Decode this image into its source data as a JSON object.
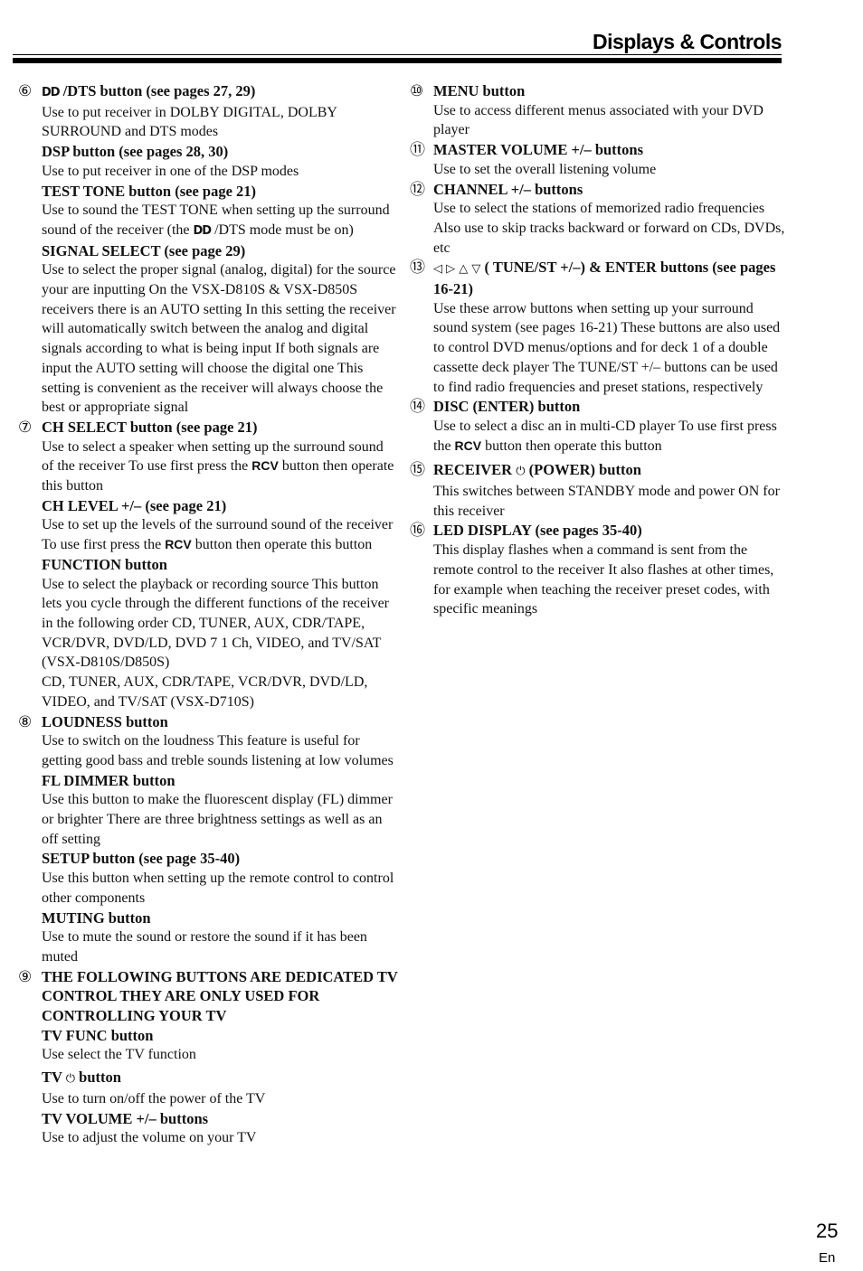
{
  "header": {
    "title": "Displays & Controls"
  },
  "footer": {
    "page_number": "25",
    "language": "En"
  },
  "icons": {
    "dolby": "DD",
    "power": "⏻",
    "arrows": "◁ ▷ △ ▽",
    "rcv": "RCV"
  },
  "left_column": {
    "item6": {
      "num": "⑥",
      "dts_heading_suffix": " /DTS  button (see pages 27, 29)",
      "dts_body": "Use to put receiver in DOLBY DIGITAL, DOLBY SURROUND and DTS modes",
      "dsp_heading": "DSP button (see pages 28, 30)",
      "dsp_body": "Use to put receiver in one of the DSP modes",
      "test_tone_heading": "TEST TONE button (see page 21)",
      "test_tone_body_a": "Use to sound the TEST TONE when setting up the surround sound of the receiver (the ",
      "test_tone_body_b": " /DTS mode must be on)",
      "signal_heading": "SIGNAL SELECT (see page 29)",
      "signal_body": "Use to select the proper signal (analog, digital) for the source your are inputting  On the VSX-D810S & VSX-D850S receivers there is an AUTO setting  In this setting the receiver will automatically switch between the analog and digital signals according to what is being input  If both signals are input the AUTO setting will choose the digital one  This setting is convenient as the receiver will always choose the best  or appropriate signal"
    },
    "item7": {
      "num": "⑦",
      "ch_select_heading": "CH SELECT button (see page 21)",
      "ch_select_body_a": "Use to select a speaker when setting up the surround sound of the receiver  To use first press the ",
      "ch_select_body_b": " button then operate this button",
      "ch_level_heading": "CH LEVEL +/– (see page 21)",
      "ch_level_body_a": "Use to set up the levels of the surround sound of the receiver  To use first press the ",
      "ch_level_body_b": " button then operate this button",
      "function_heading": "FUNCTION button",
      "function_body_1": "Use to select the playback or recording source  This button lets you cycle through the different functions of the receiver in the following order  CD, TUNER, AUX, CDR/TAPE, VCR/DVR, DVD/LD, DVD 7 1 Ch, VIDEO, and TV/SAT (VSX-D810S/D850S)",
      "function_body_2": "CD, TUNER, AUX, CDR/TAPE, VCR/DVR, DVD/LD, VIDEO, and TV/SAT (VSX-D710S)"
    },
    "item8": {
      "num": "⑧",
      "loudness_heading": "LOUDNESS button",
      "loudness_body": "Use to switch on the loudness  This feature is useful for getting good bass and treble sounds listening at low volumes",
      "fl_dimmer_heading": "FL DIMMER button",
      "fl_dimmer_body": "Use this button to make the fluorescent display (FL) dimmer or brighter  There are three brightness settings as well as an off setting",
      "setup_heading": "SETUP button (see page 35-40)",
      "setup_body": "Use this button when setting up the remote control to control other components",
      "muting_heading": "MUTING button",
      "muting_body": "Use to mute the sound or restore the sound if it has been muted"
    },
    "item9": {
      "num": "⑨",
      "heading": "THE FOLLOWING BUTTONS ARE DEDICATED TV CONTROL  THEY ARE ONLY USED FOR CONTROLLING YOUR TV",
      "tv_func_heading": "TV FUNC button",
      "tv_func_body": "Use select the TV function",
      "tv_power_heading_a": "TV ",
      "tv_power_heading_b": " button",
      "tv_power_body": "Use to turn on/off the power of the TV",
      "tv_volume_heading": "TV VOLUME +/– buttons",
      "tv_volume_body": "Use to adjust the volume on your TV"
    }
  },
  "right_column": {
    "item10": {
      "num": "⑩",
      "heading": "MENU button",
      "body": "Use to access different menus associated with your DVD player"
    },
    "item11": {
      "num": "⑪",
      "heading": "MASTER VOLUME +/– buttons",
      "body": "Use to set the overall listening volume"
    },
    "item12": {
      "num": "⑫",
      "heading": "CHANNEL +/– buttons",
      "body": "Use to select the stations of memorized radio frequencies  Also use to skip tracks backward or forward on CDs, DVDs, etc"
    },
    "item13": {
      "num": "⑬",
      "heading_suffix": " ( TUNE/ST +/–) & ENTER buttons (see pages 16-21)",
      "body": "Use these arrow buttons when setting up your surround sound system (see pages 16-21)  These buttons are also used to control DVD menus/options and for deck 1 of a double cassette deck player  The TUNE/ST +/– buttons can be used to find radio frequencies and preset stations, respectively"
    },
    "item14": {
      "num": "⑭",
      "heading": "DISC (ENTER) button",
      "body_a": "Use to select a disc an in multi-CD player   To use first press the ",
      "body_b": " button then operate this button"
    },
    "item15": {
      "num": "⑮",
      "heading_a": "RECEIVER ",
      "heading_b": " (POWER) button",
      "body": "This switches between STANDBY mode and power ON for this receiver"
    },
    "item16": {
      "num": "⑯",
      "heading": "LED DISPLAY (see pages 35-40)",
      "body": "This display flashes when a command is sent from the remote control to the receiver  It also flashes at other times, for example when teaching the receiver preset codes, with specific meanings"
    }
  }
}
